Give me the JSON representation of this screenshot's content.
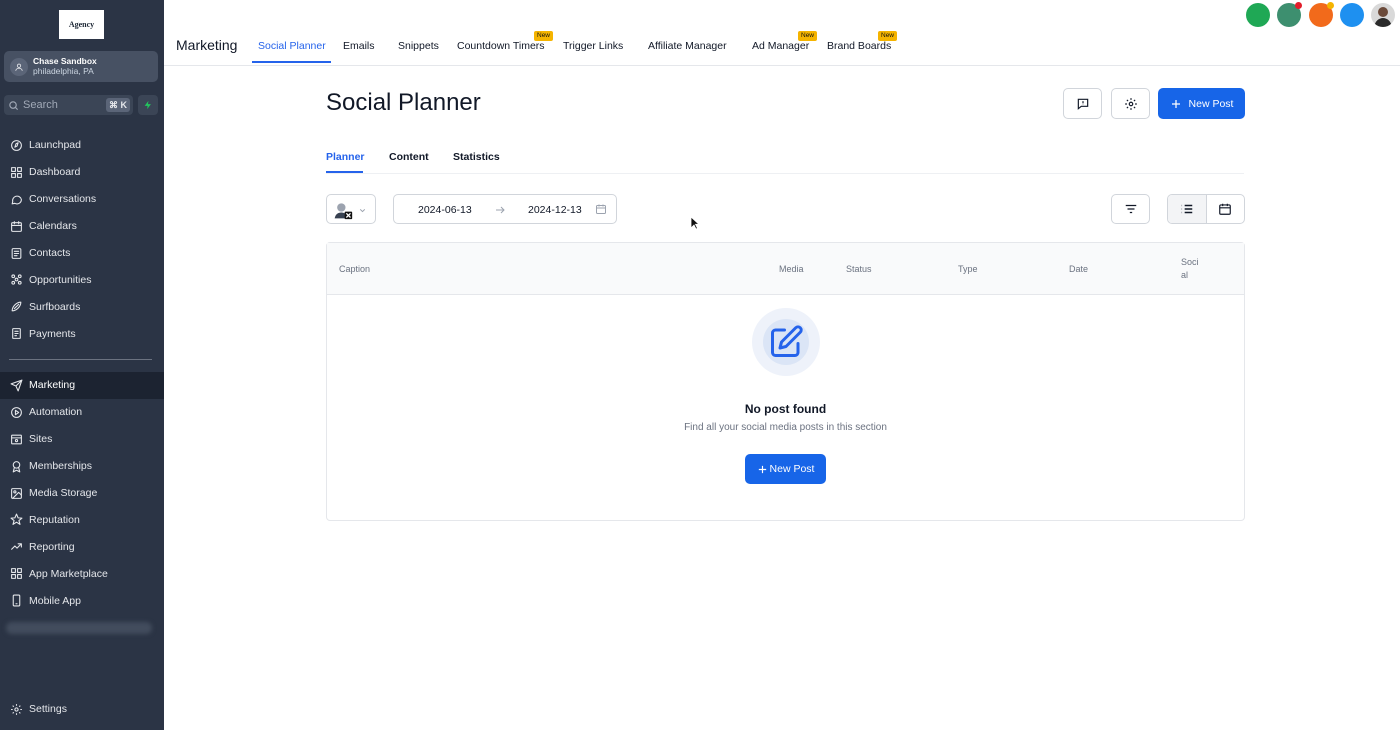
{
  "sidebar": {
    "logo_text": "Agency",
    "account": {
      "name": "Chase Sandbox",
      "location": "philadelphia, PA"
    },
    "search": {
      "placeholder": "Search",
      "shortcut": "⌘ K"
    },
    "items_top": [
      {
        "label": "Launchpad",
        "icon": "launchpad-icon"
      },
      {
        "label": "Dashboard",
        "icon": "dashboard-icon"
      },
      {
        "label": "Conversations",
        "icon": "chat-icon"
      },
      {
        "label": "Calendars",
        "icon": "calendar-icon"
      },
      {
        "label": "Contacts",
        "icon": "contacts-icon"
      },
      {
        "label": "Opportunities",
        "icon": "opportunities-icon"
      },
      {
        "label": "Surfboards",
        "icon": "surfboard-icon"
      },
      {
        "label": "Payments",
        "icon": "payments-icon"
      }
    ],
    "items_bottom": [
      {
        "label": "Marketing",
        "icon": "send-icon",
        "active": true
      },
      {
        "label": "Automation",
        "icon": "automation-icon"
      },
      {
        "label": "Sites",
        "icon": "sites-icon"
      },
      {
        "label": "Memberships",
        "icon": "badge-icon"
      },
      {
        "label": "Media Storage",
        "icon": "image-icon"
      },
      {
        "label": "Reputation",
        "icon": "star-icon"
      },
      {
        "label": "Reporting",
        "icon": "trend-icon"
      },
      {
        "label": "App Marketplace",
        "icon": "grid-icon"
      },
      {
        "label": "Mobile App",
        "icon": "phone-icon"
      }
    ],
    "settings_label": "Settings"
  },
  "topbar": {
    "section_title": "Marketing",
    "tabs": [
      {
        "label": "Social Planner",
        "active": true
      },
      {
        "label": "Emails"
      },
      {
        "label": "Snippets"
      },
      {
        "label": "Countdown Timers",
        "badge": "New"
      },
      {
        "label": "Trigger Links"
      },
      {
        "label": "Affiliate Manager"
      },
      {
        "label": "Ad Manager",
        "badge": "New"
      },
      {
        "label": "Brand Boards",
        "badge": "New"
      }
    ],
    "status_colors": [
      "#1fa855",
      "#3d8f6f",
      "#f26a1b",
      "#1e90f0"
    ]
  },
  "main": {
    "title": "Social Planner",
    "new_post_label": "New Post",
    "subtabs": [
      {
        "label": "Planner",
        "active": true
      },
      {
        "label": "Content"
      },
      {
        "label": "Statistics"
      }
    ],
    "date_start": "2024-06-13",
    "date_end": "2024-12-13",
    "table": {
      "columns": [
        "Caption",
        "Media",
        "Status",
        "Type",
        "Date",
        "Soci\nal"
      ]
    },
    "empty": {
      "title": "No post found",
      "subtitle": "Find all your social media posts in this section",
      "button_label": "New Post"
    }
  },
  "colors": {
    "accent": "#1765e8",
    "sidebar_bg": "#2b3445",
    "badge": "#f5b400"
  }
}
